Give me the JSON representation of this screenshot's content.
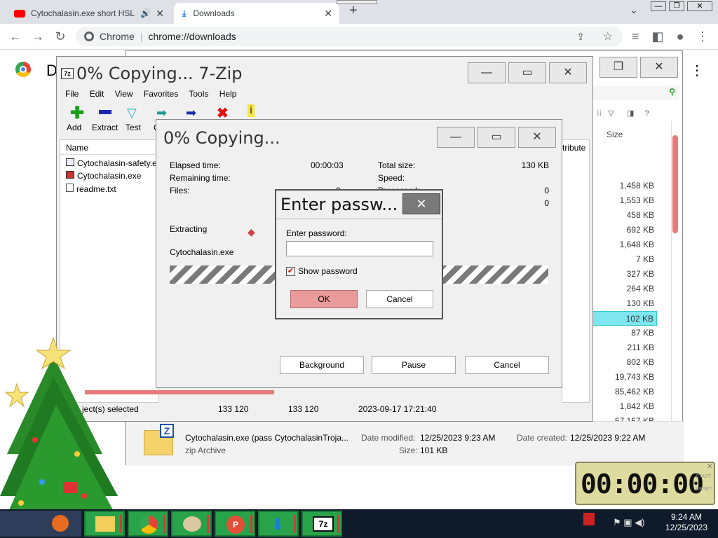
{
  "browser": {
    "tabs": [
      {
        "title": "Cytochalasin.exe short HSL T",
        "active": false
      },
      {
        "title": "Downloads",
        "active": true
      }
    ],
    "new_tab": "+",
    "omnibox_site": "Chrome",
    "omnibox_url": "chrome://downloads",
    "separator": "|"
  },
  "page_letter": "D",
  "zip_window": {
    "title": "0% Copying... 7-Zip",
    "menu": [
      "File",
      "Edit",
      "View",
      "Favorites",
      "Tools",
      "Help"
    ],
    "toolbar": [
      "Add",
      "Extract",
      "Test",
      "C"
    ],
    "column_name": "Name",
    "column_attr": "tribute",
    "files": [
      "Cytochalasin-safety.e",
      "Cytochalasin.exe",
      "readme.txt"
    ],
    "status": {
      "selected": "ject(s) selected",
      "size": "133 120",
      "packed": "133 120",
      "date": "2023-09-17 17:21:40"
    }
  },
  "copy_dialog": {
    "title": "0% Copying...",
    "elapsed_label": "Elapsed time:",
    "elapsed_value": "00:00:03",
    "remaining_label": "Remaining time:",
    "files_label": "Files:",
    "files_value": "0",
    "total_label": "Total size:",
    "total_value": "130 KB",
    "speed_label": "Speed:",
    "processed_label": "Processed:",
    "processed_value": "0",
    "packed_value": "0",
    "action": "Extracting",
    "current_file": "Cytochalasin.exe",
    "buttons": [
      "Background",
      "Pause",
      "Cancel"
    ]
  },
  "password_dialog": {
    "title": "Enter passw...",
    "label": "Enter password:",
    "value": "",
    "show_password": "Show password",
    "show_checked": true,
    "ok": "OK",
    "cancel": "Cancel"
  },
  "explorer": {
    "size_header": "Size",
    "sizes": [
      "1,458 KB",
      "1,553 KB",
      "458 KB",
      "692 KB",
      "1,648 KB",
      "7 KB",
      "327 KB",
      "264 KB",
      "130 KB",
      "102 KB",
      "87 KB",
      "211 KB",
      "802 KB",
      "19,743 KB",
      "85,462 KB",
      "1,842 KB",
      "57,157 KB"
    ],
    "selected_index": 9,
    "details": {
      "name": "Cytochalasin.exe (pass CytochalasinTroja...",
      "type": "zip Archive",
      "modified_label": "Date modified:",
      "modified": "12/25/2023 9:23 AM",
      "size_label": "Size:",
      "size": "101 KB",
      "created_label": "Date created:",
      "created": "12/25/2023 9:22 AM"
    }
  },
  "timer": {
    "display": "00:00:00",
    "start": "START",
    "reset": "RESET"
  },
  "taskbar": {
    "time": "9:24 AM",
    "date": "12/25/2023"
  },
  "colors": {
    "accent_green": "#29a34a",
    "selection": "#7fe6f0",
    "ok_button": "#e99a9a"
  }
}
